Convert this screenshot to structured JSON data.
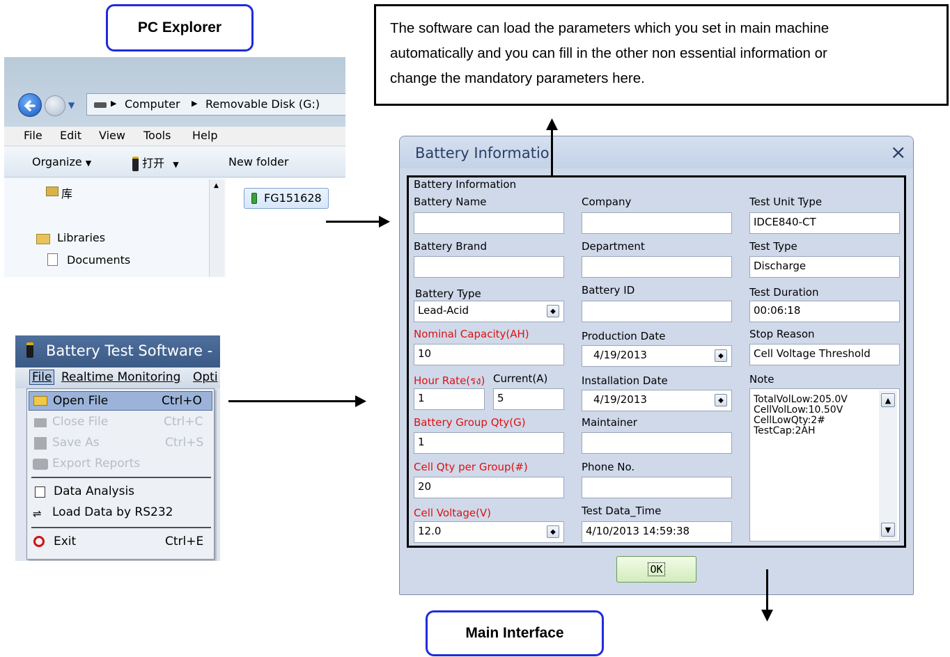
{
  "labels": {
    "pc_explorer": "PC Explorer",
    "main_interface": "Main Interface"
  },
  "note": {
    "line1": "The software can load the parameters which you set in main machine",
    "line2": "automatically and you can fill in the other non essential information or",
    "line3": "change the mandatory parameters here."
  },
  "explorer": {
    "address": {
      "computer": "Computer",
      "disk": "Removable Disk (G:)"
    },
    "menu": {
      "file": "File",
      "edit": "Edit",
      "view": "View",
      "tools": "Tools",
      "help": "Help"
    },
    "toolbar": {
      "organize": "Organize",
      "open": "打开",
      "new_folder": "New folder"
    },
    "tree": {
      "lib_cn": "库",
      "libraries": "Libraries",
      "documents": "Documents"
    },
    "file_item": "FG151628"
  },
  "software": {
    "title": "Battery Test Software - ",
    "menu": {
      "file": "File",
      "realtime": "Realtime Monitoring",
      "options": "Opti"
    },
    "items": [
      {
        "label": "Open File",
        "shortcut": "Ctrl+O"
      },
      {
        "label": "Close File",
        "shortcut": "Ctrl+C"
      },
      {
        "label": "Save As",
        "shortcut": "Ctrl+S"
      },
      {
        "label": "Export Reports",
        "shortcut": ""
      },
      {
        "label": "Data Analysis",
        "shortcut": ""
      },
      {
        "label": "Load Data by RS232",
        "shortcut": ""
      },
      {
        "label": "Exit",
        "shortcut": "Ctrl+E"
      }
    ]
  },
  "dialog": {
    "title": "Battery Informatio",
    "close": "×",
    "group": "Battery Information",
    "col1": {
      "battery_name": {
        "label": "Battery Name",
        "value": ""
      },
      "battery_brand": {
        "label": "Battery Brand",
        "value": ""
      },
      "battery_type": {
        "label": "Battery Type",
        "value": "Lead-Acid"
      },
      "nominal_capacity": {
        "label": "Nominal Capacity(AH)",
        "value": "10"
      },
      "hour_rate": {
        "label": "Hour Rate(รง)",
        "value": "1"
      },
      "current": {
        "label": "Current(A)",
        "value": "5"
      },
      "group_qty": {
        "label": "Battery Group Qty(G)",
        "value": "1"
      },
      "cell_qty": {
        "label": "Cell Qty per Group(#)",
        "value": "20"
      },
      "cell_voltage": {
        "label": "Cell Voltage(V)",
        "value": "12.0"
      }
    },
    "col2": {
      "company": {
        "label": "Company",
        "value": ""
      },
      "department": {
        "label": "Department",
        "value": ""
      },
      "battery_id": {
        "label": "Battery ID",
        "value": ""
      },
      "production_date": {
        "label": "Production Date",
        "value": "4/19/2013"
      },
      "installation_date": {
        "label": "Installation Date",
        "value": "4/19/2013"
      },
      "maintainer": {
        "label": "Maintainer",
        "value": ""
      },
      "phone": {
        "label": "Phone No.",
        "value": ""
      },
      "test_time": {
        "label": "Test Data_Time",
        "value": "4/10/2013 14:59:38"
      }
    },
    "col3": {
      "unit_type": {
        "label": "Test Unit Type",
        "value": "IDCE840-CT"
      },
      "test_type": {
        "label": "Test Type",
        "value": "Discharge"
      },
      "duration": {
        "label": "Test Duration",
        "value": "00:06:18"
      },
      "stop_reason": {
        "label": "Stop Reason",
        "value": "Cell Voltage Threshold"
      },
      "note_label": "Note",
      "note_lines": [
        "TotalVolLow:205.0V",
        "CellVolLow:10.50V",
        "CellLowQty:2#",
        "TestCap:2AH"
      ]
    },
    "ok": "OK"
  }
}
